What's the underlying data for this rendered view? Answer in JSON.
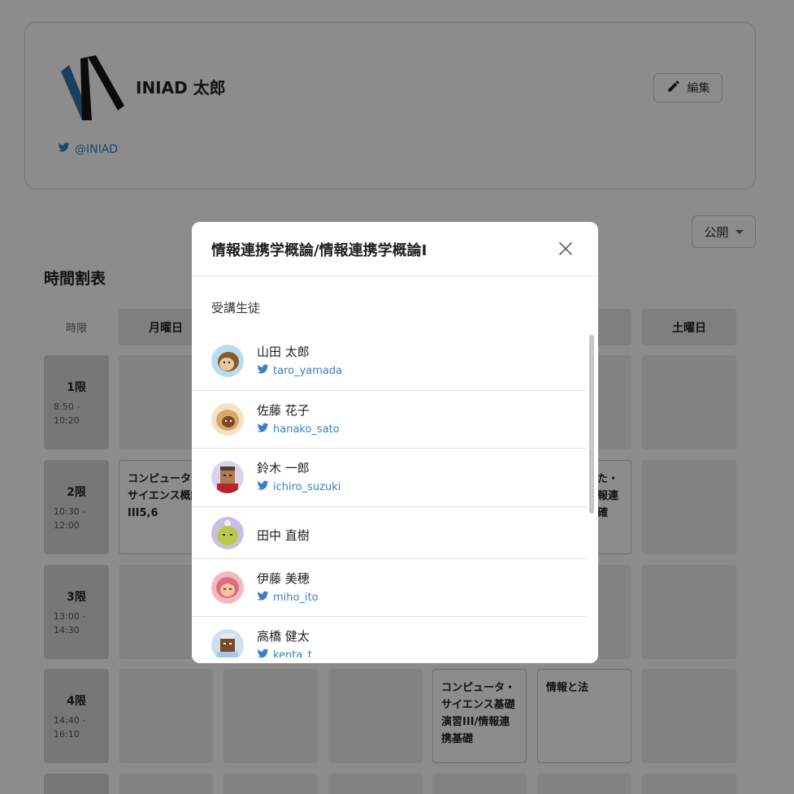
{
  "profile": {
    "name": "INIAD 太郎",
    "twitter": "@INIAD",
    "edit_label": "編集"
  },
  "visibility": {
    "selected": "公開"
  },
  "timetable": {
    "title": "時間割表",
    "period_header": "時限",
    "days": [
      "月曜日",
      "",
      "",
      "",
      "",
      "土曜日"
    ],
    "periods": [
      {
        "label": "1限",
        "start": "8:50 -",
        "end": "10:20"
      },
      {
        "label": "2限",
        "start": "10:30 -",
        "end": "12:00"
      },
      {
        "label": "3限",
        "start": "13:00 -",
        "end": "14:30"
      },
      {
        "label": "4限",
        "start": "14:40 -",
        "end": "16:10"
      }
    ],
    "courses": {
      "mon2": "コンピュータ・サイエンス概論III5,6",
      "fri2": "のた・統報連の確",
      "thu4": "コンピュータ・サイエンス基礎演習III/情報連携基礎",
      "fri4": "情報と法"
    }
  },
  "modal": {
    "title": "情報連携学概論/情報連携学概論I",
    "subtitle": "受講生徒",
    "students": [
      {
        "name": "山田 太郎",
        "twitter": "taro_yamada"
      },
      {
        "name": "佐藤 花子",
        "twitter": "hanako_sato"
      },
      {
        "name": "鈴木 一郎",
        "twitter": "ichiro_suzuki"
      },
      {
        "name": "田中 直樹",
        "twitter": ""
      },
      {
        "name": "伊藤 美穂",
        "twitter": "miho_ito"
      },
      {
        "name": "高橋 健太",
        "twitter": "kenta_t"
      }
    ]
  },
  "colors": {
    "twitter_blue": "#3a7fbf",
    "overlay": "rgba(0,0,0,0.45)"
  }
}
